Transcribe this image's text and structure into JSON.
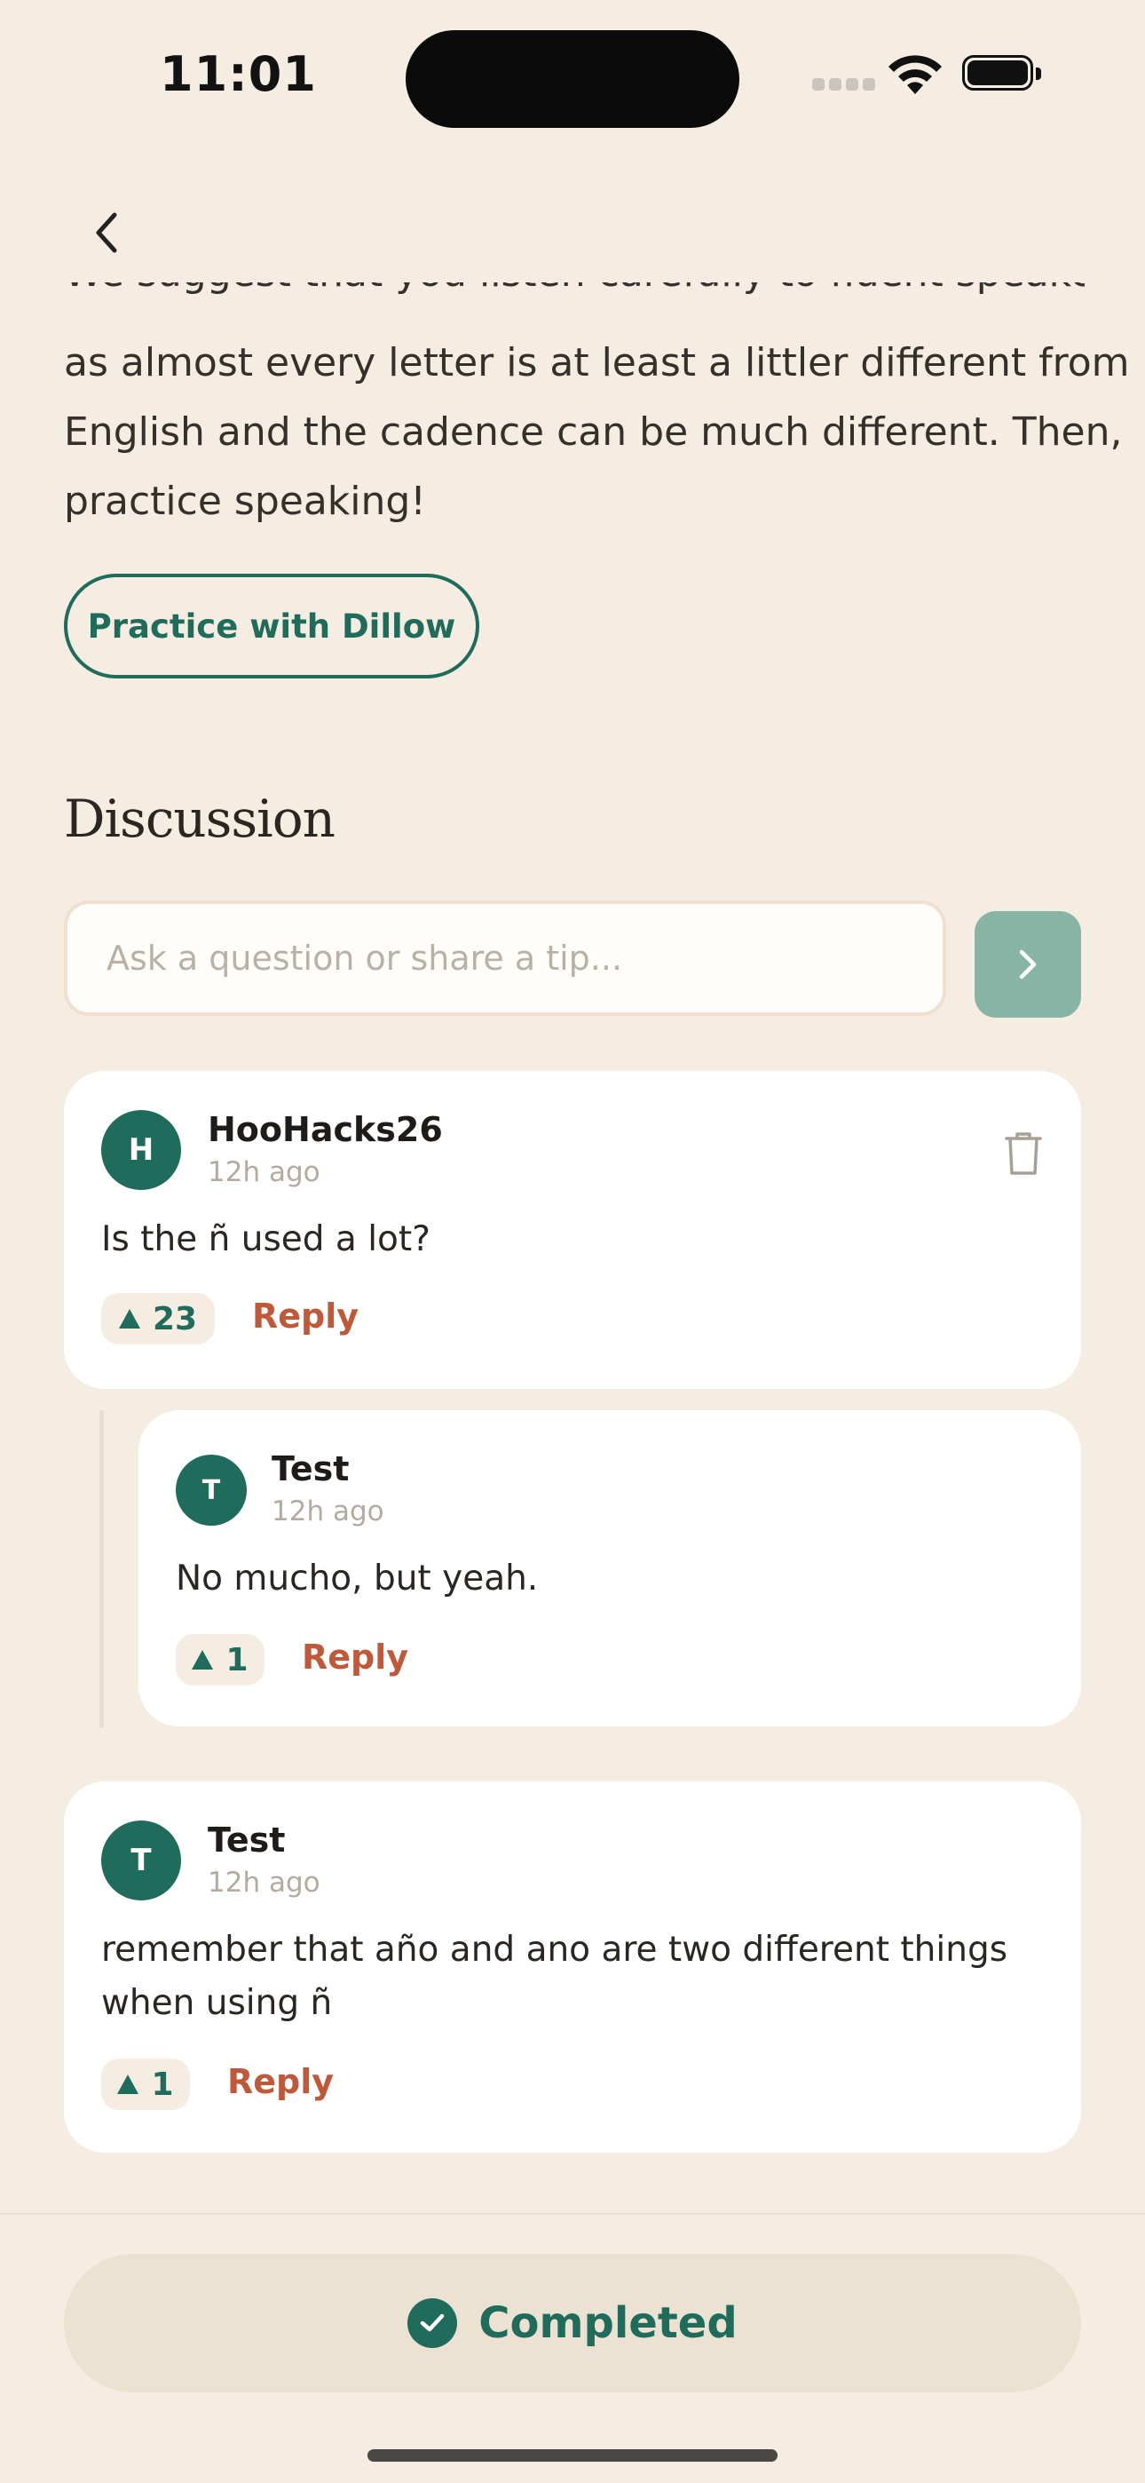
{
  "status_bar": {
    "time": "11:01"
  },
  "lesson": {
    "clipped_line": "We suggest that you listen carefully to fluent speakers,",
    "intro_lines": [
      "as almost every letter is at least a littler different from",
      "English and the cadence can be much different. Then,",
      "practice speaking!"
    ],
    "practice_button": "Practice with Dillow"
  },
  "discussion": {
    "title": "Discussion",
    "input_placeholder": "Ask a question or share a tip...",
    "input_value": "",
    "comments": [
      {
        "initial": "H",
        "author": "HooHacks26",
        "time": "12h ago",
        "text": "Is the ñ used a lot?",
        "votes": "23",
        "reply_label": "Reply",
        "replies": [
          {
            "initial": "T",
            "author": "Test",
            "time": "12h ago",
            "text": "No mucho, but yeah.",
            "votes": "1",
            "reply_label": "Reply"
          }
        ]
      },
      {
        "initial": "T",
        "author": "Test",
        "time": "12h ago",
        "text_lines": [
          "remember that año and ano are two different things",
          "when using ñ"
        ],
        "votes": "1",
        "reply_label": "Reply"
      }
    ]
  },
  "footer": {
    "completed_label": "Completed"
  },
  "colors": {
    "background": "#f5ede1",
    "accent_green": "#1f6b5c",
    "reply_orange": "#c0583a",
    "send_button": "#88b4a5"
  },
  "icons": [
    "back-chevron-icon",
    "send-chevron-icon",
    "trash-icon",
    "upvote-icon",
    "check-circle-icon",
    "wifi-icon",
    "battery-icon",
    "cellular-icon"
  ]
}
